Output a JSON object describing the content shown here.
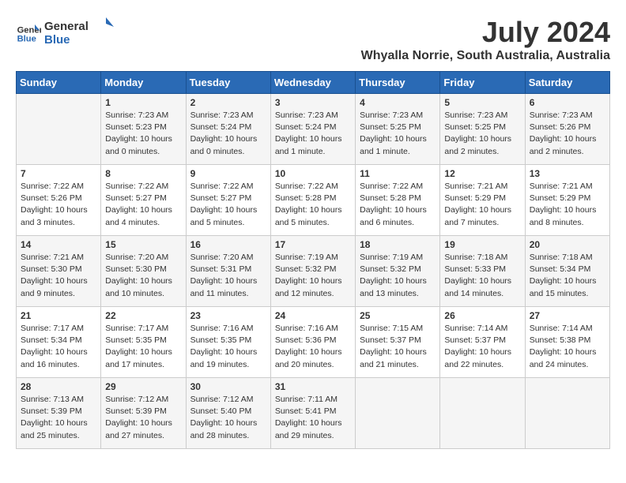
{
  "logo": {
    "line1": "General",
    "line2": "Blue"
  },
  "title": "July 2024",
  "subtitle": "Whyalla Norrie, South Australia, Australia",
  "days_of_week": [
    "Sunday",
    "Monday",
    "Tuesday",
    "Wednesday",
    "Thursday",
    "Friday",
    "Saturday"
  ],
  "weeks": [
    [
      {
        "day": "",
        "info": ""
      },
      {
        "day": "1",
        "info": "Sunrise: 7:23 AM\nSunset: 5:23 PM\nDaylight: 10 hours\nand 0 minutes."
      },
      {
        "day": "2",
        "info": "Sunrise: 7:23 AM\nSunset: 5:24 PM\nDaylight: 10 hours\nand 0 minutes."
      },
      {
        "day": "3",
        "info": "Sunrise: 7:23 AM\nSunset: 5:24 PM\nDaylight: 10 hours\nand 1 minute."
      },
      {
        "day": "4",
        "info": "Sunrise: 7:23 AM\nSunset: 5:25 PM\nDaylight: 10 hours\nand 1 minute."
      },
      {
        "day": "5",
        "info": "Sunrise: 7:23 AM\nSunset: 5:25 PM\nDaylight: 10 hours\nand 2 minutes."
      },
      {
        "day": "6",
        "info": "Sunrise: 7:23 AM\nSunset: 5:26 PM\nDaylight: 10 hours\nand 2 minutes."
      }
    ],
    [
      {
        "day": "7",
        "info": "Sunrise: 7:22 AM\nSunset: 5:26 PM\nDaylight: 10 hours\nand 3 minutes."
      },
      {
        "day": "8",
        "info": "Sunrise: 7:22 AM\nSunset: 5:27 PM\nDaylight: 10 hours\nand 4 minutes."
      },
      {
        "day": "9",
        "info": "Sunrise: 7:22 AM\nSunset: 5:27 PM\nDaylight: 10 hours\nand 5 minutes."
      },
      {
        "day": "10",
        "info": "Sunrise: 7:22 AM\nSunset: 5:28 PM\nDaylight: 10 hours\nand 5 minutes."
      },
      {
        "day": "11",
        "info": "Sunrise: 7:22 AM\nSunset: 5:28 PM\nDaylight: 10 hours\nand 6 minutes."
      },
      {
        "day": "12",
        "info": "Sunrise: 7:21 AM\nSunset: 5:29 PM\nDaylight: 10 hours\nand 7 minutes."
      },
      {
        "day": "13",
        "info": "Sunrise: 7:21 AM\nSunset: 5:29 PM\nDaylight: 10 hours\nand 8 minutes."
      }
    ],
    [
      {
        "day": "14",
        "info": "Sunrise: 7:21 AM\nSunset: 5:30 PM\nDaylight: 10 hours\nand 9 minutes."
      },
      {
        "day": "15",
        "info": "Sunrise: 7:20 AM\nSunset: 5:30 PM\nDaylight: 10 hours\nand 10 minutes."
      },
      {
        "day": "16",
        "info": "Sunrise: 7:20 AM\nSunset: 5:31 PM\nDaylight: 10 hours\nand 11 minutes."
      },
      {
        "day": "17",
        "info": "Sunrise: 7:19 AM\nSunset: 5:32 PM\nDaylight: 10 hours\nand 12 minutes."
      },
      {
        "day": "18",
        "info": "Sunrise: 7:19 AM\nSunset: 5:32 PM\nDaylight: 10 hours\nand 13 minutes."
      },
      {
        "day": "19",
        "info": "Sunrise: 7:18 AM\nSunset: 5:33 PM\nDaylight: 10 hours\nand 14 minutes."
      },
      {
        "day": "20",
        "info": "Sunrise: 7:18 AM\nSunset: 5:34 PM\nDaylight: 10 hours\nand 15 minutes."
      }
    ],
    [
      {
        "day": "21",
        "info": "Sunrise: 7:17 AM\nSunset: 5:34 PM\nDaylight: 10 hours\nand 16 minutes."
      },
      {
        "day": "22",
        "info": "Sunrise: 7:17 AM\nSunset: 5:35 PM\nDaylight: 10 hours\nand 17 minutes."
      },
      {
        "day": "23",
        "info": "Sunrise: 7:16 AM\nSunset: 5:35 PM\nDaylight: 10 hours\nand 19 minutes."
      },
      {
        "day": "24",
        "info": "Sunrise: 7:16 AM\nSunset: 5:36 PM\nDaylight: 10 hours\nand 20 minutes."
      },
      {
        "day": "25",
        "info": "Sunrise: 7:15 AM\nSunset: 5:37 PM\nDaylight: 10 hours\nand 21 minutes."
      },
      {
        "day": "26",
        "info": "Sunrise: 7:14 AM\nSunset: 5:37 PM\nDaylight: 10 hours\nand 22 minutes."
      },
      {
        "day": "27",
        "info": "Sunrise: 7:14 AM\nSunset: 5:38 PM\nDaylight: 10 hours\nand 24 minutes."
      }
    ],
    [
      {
        "day": "28",
        "info": "Sunrise: 7:13 AM\nSunset: 5:39 PM\nDaylight: 10 hours\nand 25 minutes."
      },
      {
        "day": "29",
        "info": "Sunrise: 7:12 AM\nSunset: 5:39 PM\nDaylight: 10 hours\nand 27 minutes."
      },
      {
        "day": "30",
        "info": "Sunrise: 7:12 AM\nSunset: 5:40 PM\nDaylight: 10 hours\nand 28 minutes."
      },
      {
        "day": "31",
        "info": "Sunrise: 7:11 AM\nSunset: 5:41 PM\nDaylight: 10 hours\nand 29 minutes."
      },
      {
        "day": "",
        "info": ""
      },
      {
        "day": "",
        "info": ""
      },
      {
        "day": "",
        "info": ""
      }
    ]
  ]
}
